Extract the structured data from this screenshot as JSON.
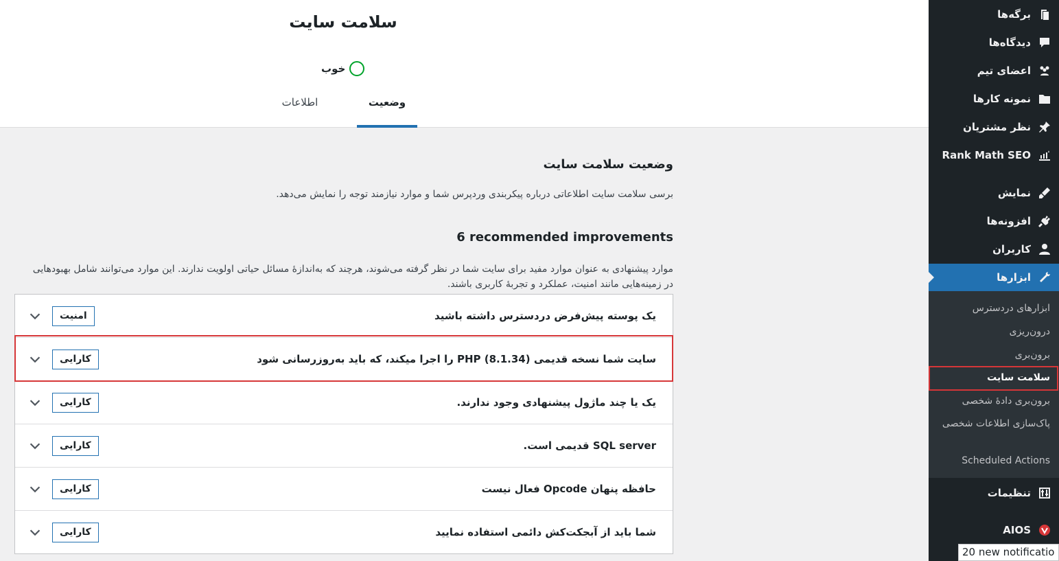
{
  "page_title": "سلامت سایت",
  "status": {
    "label": "خوب"
  },
  "tabs": {
    "status": "وضعیت",
    "info": "اطلاعات"
  },
  "section": {
    "title": "وضعیت سلامت سایت",
    "description": "برسی سلامت سایت اطلاعاتی درباره پیکربندی وردپرس شما و موارد نیازمند توجه را نمایش می‌دهد."
  },
  "improvements": {
    "title": "6 recommended improvements",
    "description": "موارد پیشنهادی به عنوان موارد مفید برای سایت شما در نظر گرفته می‌شوند، هرچند که به‌اندازهٔ مسائل حیاتی اولویت ندارند. این موارد می‌توانند شامل بهبودهایی در زمینه‌هایی مانند امنیت، عملکرد و تجربهٔ کاربری باشند.",
    "items": [
      {
        "title": "یک پوسته پیش‌فرض دردسترس داشته باشید",
        "badge": "امنیت"
      },
      {
        "title": "سایت شما نسخه قدیمی PHP (8.1.34) را اجرا میکند، که باید به‌روزرسانی شود",
        "badge": "کارایی"
      },
      {
        "title": "یک یا چند ماژول پیشنهادی وجود ندارند.",
        "badge": "کارایی"
      },
      {
        "title": "SQL server قدیمی است.",
        "badge": "کارایی"
      },
      {
        "title": "حافظه پنهان Opcode فعال نیست",
        "badge": "کارایی"
      },
      {
        "title": "شما باید از آبجکت‌کش دائمی استفاده نمایید",
        "badge": "کارایی"
      }
    ]
  },
  "sidebar": {
    "items": [
      {
        "label": "برگه‌ها",
        "icon": "pages-icon"
      },
      {
        "label": "دیدگاه‌ها",
        "icon": "comments-icon"
      },
      {
        "label": "اعضای تیم",
        "icon": "team-icon"
      },
      {
        "label": "نمونه کارها",
        "icon": "folder-icon"
      },
      {
        "label": "نظر مشتریان",
        "icon": "pin-icon"
      },
      {
        "label": "Rank Math SEO",
        "icon": "rank-math-icon"
      },
      {
        "label": "نمایش",
        "icon": "appearance-icon"
      },
      {
        "label": "افزونه‌ها",
        "icon": "plugins-icon"
      },
      {
        "label": "کاربران",
        "icon": "users-icon"
      },
      {
        "label": "ابزارها",
        "icon": "tools-icon"
      },
      {
        "label": "تنظیمات",
        "icon": "settings-icon"
      },
      {
        "label": "AIOS",
        "icon": "aios-icon"
      }
    ],
    "submenu": [
      "ابزارهای دردسترس",
      "درون‌ریزی",
      "برون‌بری",
      "سلامت سایت",
      "برون‌بری دادهٔ شخصی",
      "پاک‌سازی اطلاعات شخصی",
      "Scheduled Actions"
    ]
  },
  "tooltip": "20 new notificatio",
  "colors": {
    "accent": "#2271b1",
    "sidebar": "#1d2327",
    "good": "#00a32a",
    "highlight": "#d63638"
  }
}
